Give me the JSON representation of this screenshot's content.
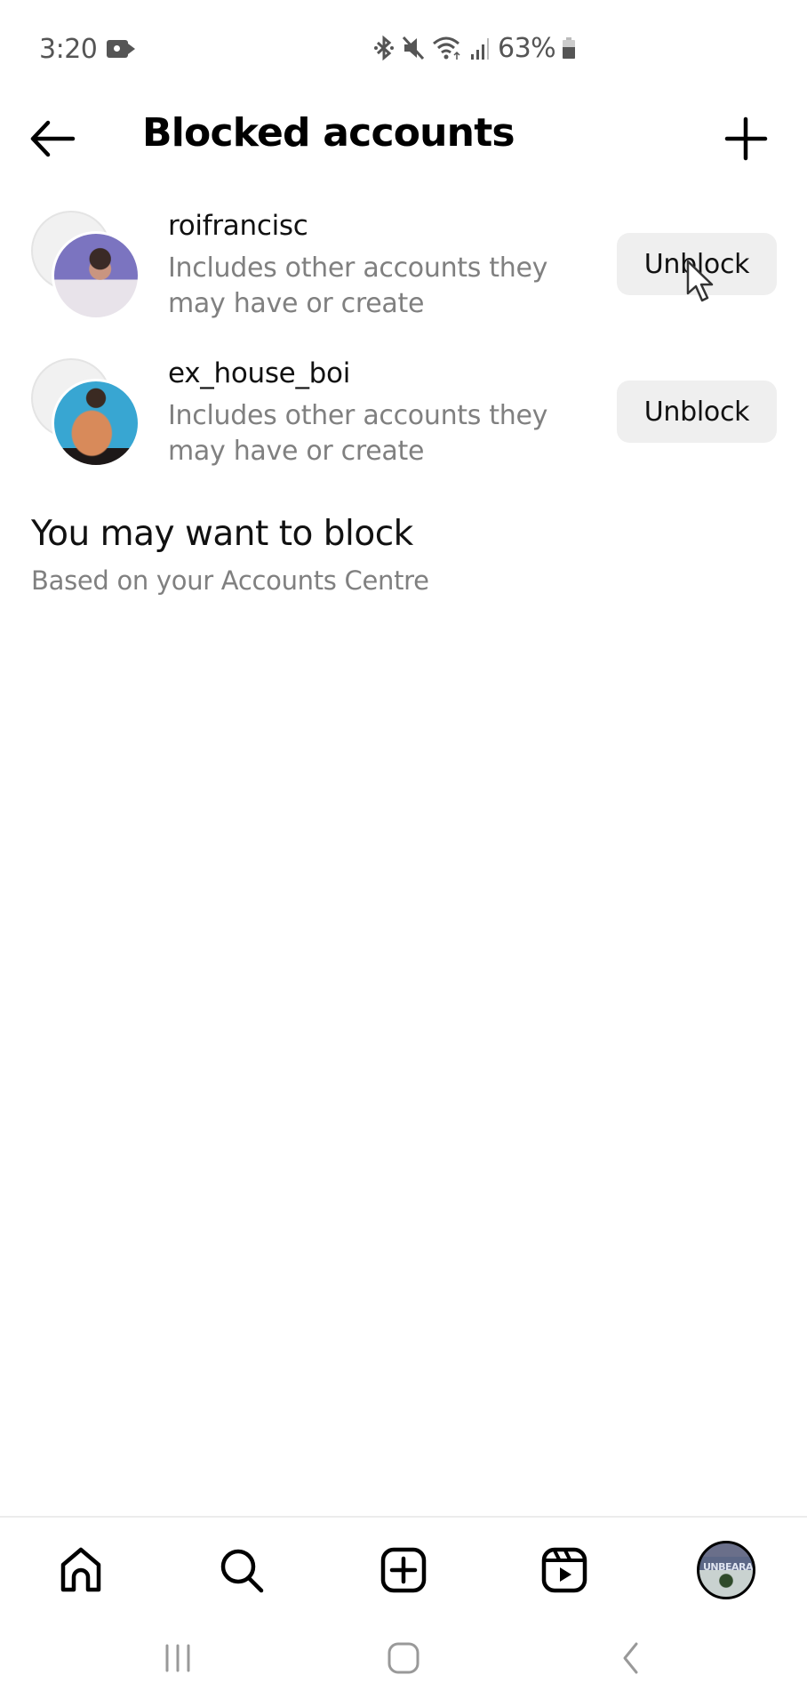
{
  "status_bar": {
    "time": "3:20",
    "battery_percent_label": "63%",
    "battery_level": 0.63,
    "icons": [
      "video-recording-icon",
      "bluetooth-icon",
      "mute-icon",
      "wifi-icon",
      "signal-icon",
      "battery-icon"
    ]
  },
  "header": {
    "back_icon": "arrow-left-icon",
    "title": "Blocked accounts",
    "add_icon": "plus-icon"
  },
  "blocked_accounts": [
    {
      "username": "roifrancisc",
      "description": "Includes other accounts they may have or create",
      "action_label": "Unblock",
      "avatar_colors": [
        "#6b6fb5",
        "#e9e6ea",
        "#b58a7a"
      ]
    },
    {
      "username": "ex_house_boi",
      "description": "Includes other accounts they may have or create",
      "action_label": "Unblock",
      "avatar_colors": [
        "#3aa6cf",
        "#d98a5c",
        "#2a2020"
      ]
    }
  ],
  "suggestions": {
    "title": "You may want to block",
    "subtitle": "Based on your Accounts Centre"
  },
  "bottom_nav": {
    "items": [
      {
        "name": "home",
        "icon": "home-icon"
      },
      {
        "name": "search",
        "icon": "search-icon"
      },
      {
        "name": "create",
        "icon": "plus-square-icon"
      },
      {
        "name": "reels",
        "icon": "reels-icon"
      },
      {
        "name": "profile",
        "icon": "profile-avatar",
        "avatar_text": "UNBEARA"
      }
    ]
  },
  "system_nav": {
    "items": [
      "recent-apps-icon",
      "home-circle-icon",
      "back-chevron-icon"
    ]
  }
}
